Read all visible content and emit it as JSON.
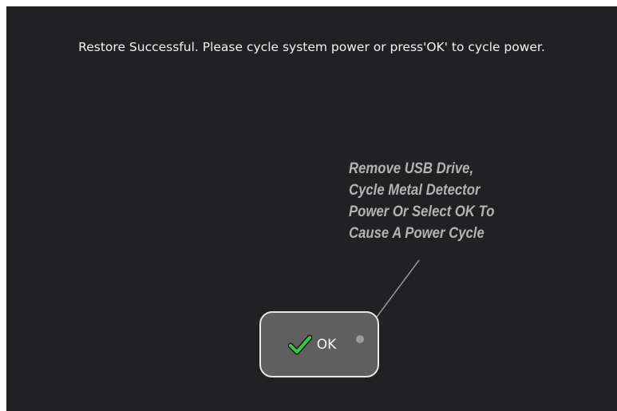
{
  "dialog": {
    "message": "Restore Successful. Please cycle system power or press'OK' to cycle power."
  },
  "annotation": {
    "lines": [
      "Remove USB Drive,",
      "Cycle Metal Detector",
      "Power Or Select OK To",
      "Cause A Power Cycle"
    ],
    "color": "#b3b3b3"
  },
  "ok_button": {
    "label": "OK",
    "icon": "checkmark-icon",
    "icon_color": "#2ecc40"
  },
  "colors": {
    "screen_background": "#212124",
    "button_background": "#5f5f5f",
    "button_border": "#e6e6e6",
    "text": "#f2f2f2"
  }
}
